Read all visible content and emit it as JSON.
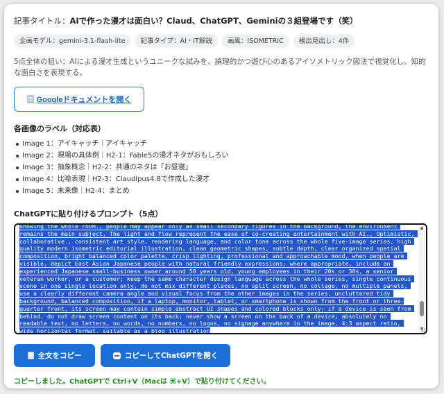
{
  "header": {
    "title_label": "記事タイトル：",
    "title_value": "AIで作った漫才は面白い？Claud、ChatGPT、Geminiの３組登場です（笑）"
  },
  "chips": [
    "企画モデル：gemini-3.1-flash-lite",
    "記事タイプ：AI・IT解説",
    "画風：ISOMETRIC",
    "検出見出し：4件"
  ],
  "description": "5点全体の狙い：AIによる漫才生成というユニークな試みを、論理的かつ遊び心のあるアイソメトリック図法で視覚化し、知的な面白さを表現する。",
  "doc_button": {
    "label": "Googleドキュメントを開く",
    "icon": "document-icon"
  },
  "labels_section": {
    "heading": "各画像のラベル（対応表）",
    "items": [
      "Image 1：アイキャッチ｜アイキャッチ",
      "Image 2：現場の具体例｜H2-1：Fable5の漫才ネタがおもしろい",
      "Image 3：抽象概念｜H2-2：共通のネタは「お昼寝」",
      "Image 4：比喩表現｜H2-3：Claudlpus4.8で作成した漫才",
      "Image 5：未来像｜H2-4：まとめ"
    ]
  },
  "prompt_section": {
    "heading": "ChatGPTに貼り付けるプロンプト（5点）",
    "text": "showing the whole room., people may appear only as small secondary figures in the background, the environment remains the main subject, The light and flow represent the ease of co-creating entertainment with AI., Optimistic, collaborative., consistent art style, rendering language, and color tone across the whole five-image series, high quality modern isometric editorial illustration, clean geometric shapes, subtle depth, clear organized spatial composition, bright balanced color palette, crisp lighting, professional and approachable mood, when people are visible, depict East Asian Japanese people with natural friendly expressions; where appropriate, include an experienced Japanese small-business owner around 50 years old, young employees in their 20s or 30s, a senior veteran worker, or a customer; keep the same character design language across the whole series, single continuous scene in one single location only, do not mix different places, no split screen, no collage, no multiple panels, use a clearly different camera angle and visual focus from the other images in the series, uncluttered tidy background, balanced composition, if a laptop, monitor, tablet, or smartphone is shown from the front or three-quarter front, its screen may contain simple abstract UI shapes and colored blocks only; if a device is seen from behind, do not draw screen content on its back; never show a screen on the back of a device; absolutely no readable text, no letters, no words, no numbers, no logos, no signage anywhere in the image, 4:3 aspect ratio, wide horizontal format, suitable as a blog illustration"
  },
  "buttons": {
    "copy_all": "全文をコピー",
    "copy_open": "コピーしてChatGPTを開く"
  },
  "status": "コピーしました。ChatGPTで Ctrl+V（Macは ⌘+V）で貼り付けてください。",
  "colors": {
    "accent": "#1c6fd6",
    "selection": "#2456c8",
    "success": "#2a8a2a"
  }
}
